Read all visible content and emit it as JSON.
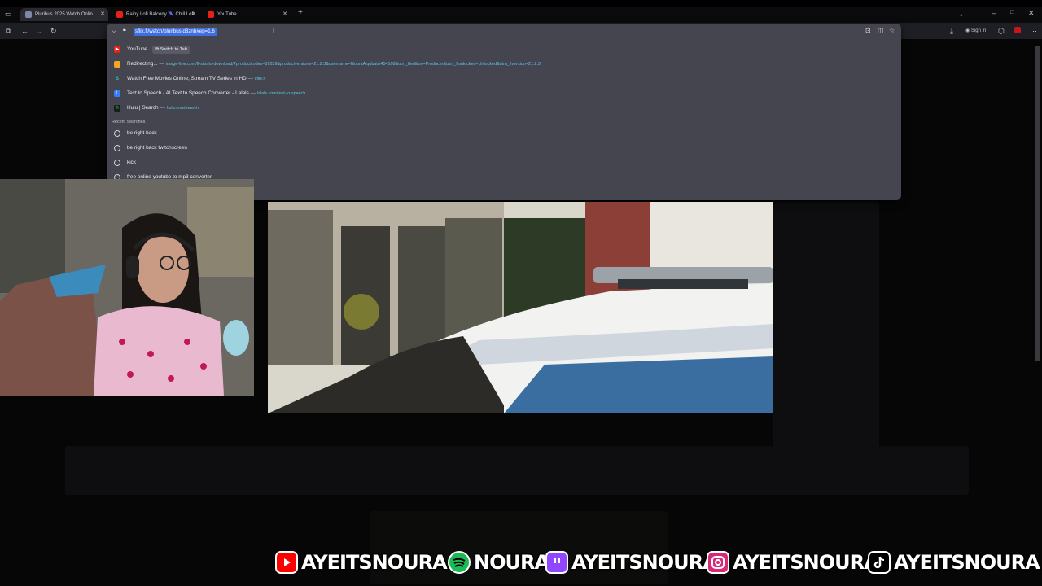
{
  "browser": {
    "tabs": [
      {
        "title": "Pluribus 2025 Watch Onlin",
        "active": true
      },
      {
        "title": "Rainy Lofi Balcony 🌂 Chill Lofi",
        "active": false
      },
      {
        "title": "YouTube",
        "active": false
      }
    ],
    "new_tab_label": "+",
    "signin_label": "Sign in",
    "url": "sflix.fi/watch/pluribus.d3znb#ep=1.6"
  },
  "omnibox": {
    "suggestions": [
      {
        "title": "YouTube",
        "switch_label": "Switch to Tab",
        "icon": "youtube-icon",
        "color": "#e62117"
      },
      {
        "title": "Redirecting...",
        "url": "image-line.com/fl-studio-download/?productcodes=31039&productversions=21.2.3&username=NouraAlqubaisi454108&utm_fledition=Producer&utm_flunlocked=Unlocked&utm_flversion=21.2.3",
        "icon": "image-line-icon",
        "color": "#f5a623"
      },
      {
        "title": "Watch Free Movies Online, Stream TV Series in HD",
        "url": "sflix.fi",
        "icon": "sflix-icon",
        "color": "#1ec5b8"
      },
      {
        "title": "Text to Speech - AI Text to Speech Converter - Lalals",
        "url": "lalals.com/text-to-speech",
        "icon": "lalals-icon",
        "color": "#3b7bff"
      },
      {
        "title": "Hulu | Search",
        "url": "hulu.com/search",
        "icon": "hulu-icon",
        "color": "#1ce783"
      }
    ],
    "recent_header": "Recent Searches",
    "recent": [
      "be right back",
      "be right back twitchscreen",
      "kick",
      "free online youtube to mp3 converter"
    ]
  },
  "social": [
    {
      "platform": "youtube-icon",
      "handle": "AYEITSNOURA",
      "color": "#ff0000"
    },
    {
      "platform": "spotify-icon",
      "handle": "NOURA",
      "color": "#1db954"
    },
    {
      "platform": "twitch-icon",
      "handle": "AYEITSNOURA",
      "color": "#9146ff"
    },
    {
      "platform": "instagram-icon",
      "handle": "AYEITSNOURA",
      "color": "#d62976"
    },
    {
      "platform": "tiktok-icon",
      "handle": "AYEITSNOURA",
      "color": "#000000"
    }
  ]
}
